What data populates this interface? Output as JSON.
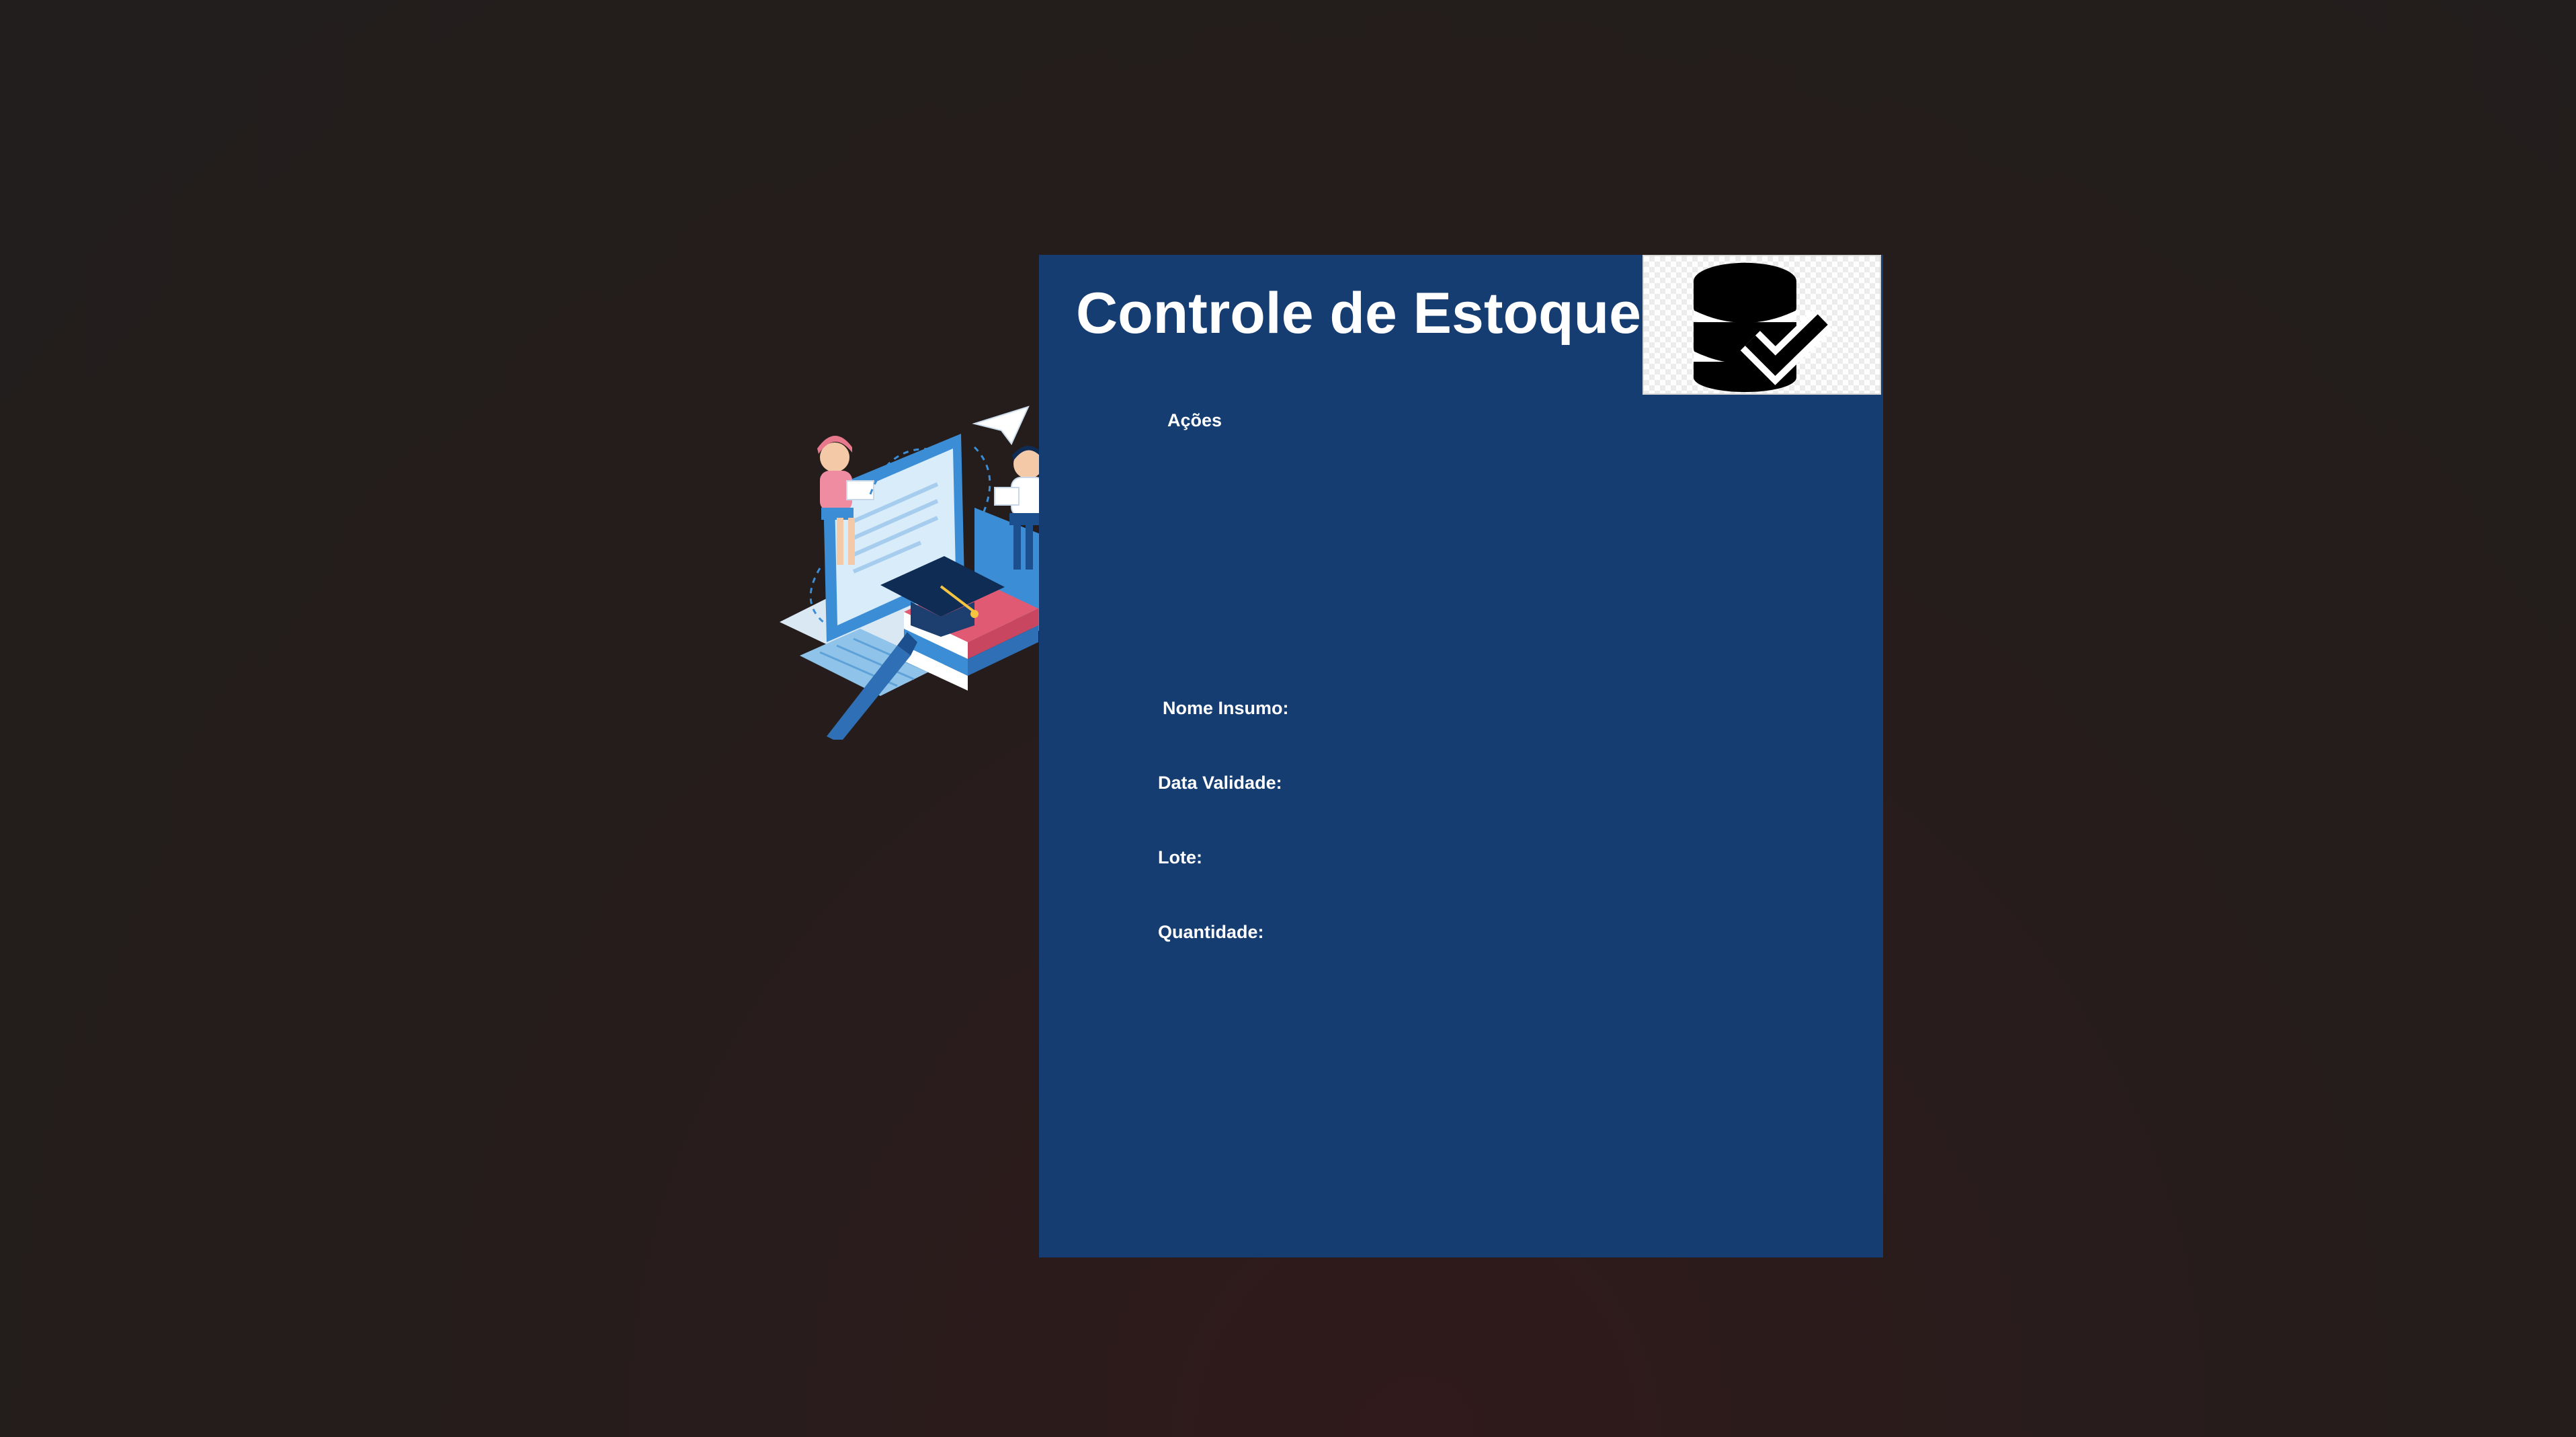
{
  "form": {
    "title": "Controle de Estoque",
    "actions_label": "Ações",
    "fields": {
      "nome_insumo": "Nome Insumo:",
      "data_validade": "Data Validade:",
      "lote": "Lote:",
      "quantidade": "Quantidade:"
    }
  },
  "icons": {
    "logo": "database-check-icon",
    "illustration": "study-people-illustration"
  },
  "colors": {
    "background": "#231e1d",
    "panel": "#163d72",
    "text": "#ffffff"
  }
}
